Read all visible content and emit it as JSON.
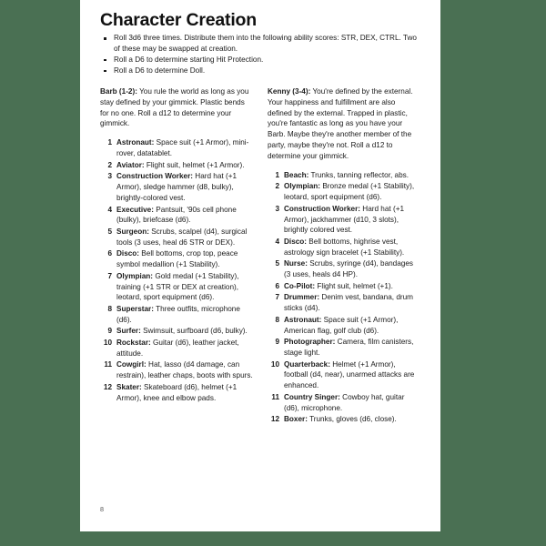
{
  "page": {
    "title": "Character Creation",
    "number": "8",
    "background_color": "#4a7053",
    "paper_color": "#ffffff"
  },
  "intro_rules": [
    "Roll 3d6 three times. Distribute them into the following ability scores: STR, DEX, CTRL. Two of these may be swapped at creation.",
    "Roll a D6 to determine starting Hit Protection.",
    "Roll a D6 to determine Doll."
  ],
  "columns": [
    {
      "heading": "Barb (1-2):",
      "intro": " You rule the world as long as you stay defined by your gimmick. Plastic bends for no one. Roll a d12 to determine your gimmick.",
      "items": [
        {
          "num": "1",
          "name": "Astronaut:",
          "text": " Space suit (+1 Armor), mini-rover, datatablet."
        },
        {
          "num": "2",
          "name": "Aviator:",
          "text": " Flight suit, helmet (+1 Armor)."
        },
        {
          "num": "3",
          "name": "Construction Worker:",
          "text": " Hard hat (+1 Armor), sledge hammer (d8, bulky), brightly-colored vest."
        },
        {
          "num": "4",
          "name": "Executive:",
          "text": " Pantsuit, '90s cell phone (bulky), briefcase (d6)."
        },
        {
          "num": "5",
          "name": "Surgeon:",
          "text": " Scrubs, scalpel (d4), surgical tools (3 uses, heal d6 STR or DEX)."
        },
        {
          "num": "6",
          "name": "Disco:",
          "text": " Bell bottoms, crop top, peace symbol medallion (+1 Stability)."
        },
        {
          "num": "7",
          "name": "Olympian:",
          "text": " Gold medal (+1 Stability), training (+1 STR or DEX at creation), leotard, sport equipment (d6)."
        },
        {
          "num": "8",
          "name": "Superstar:",
          "text": " Three outfits, microphone (d6)."
        },
        {
          "num": "9",
          "name": "Surfer:",
          "text": " Swimsuit, surfboard (d6, bulky)."
        },
        {
          "num": "10",
          "name": "Rockstar:",
          "text": " Guitar (d6), leather jacket, attitude."
        },
        {
          "num": "11",
          "name": "Cowgirl:",
          "text": " Hat, lasso (d4 damage, can restrain), leather chaps, boots with spurs."
        },
        {
          "num": "12",
          "name": "Skater:",
          "text": " Skateboard (d6), helmet (+1 Armor), knee and elbow pads."
        }
      ]
    },
    {
      "heading": "Kenny (3-4):",
      "intro": " You're defined by the external. Your happiness and fulfillment are also defined by the external.  Trapped in plastic, you're fantastic as long as you have your Barb. Maybe they're another member of the party, maybe they're not. Roll a d12 to determine your gimmick.",
      "items": [
        {
          "num": "1",
          "name": "Beach:",
          "text": " Trunks, tanning reflector, abs."
        },
        {
          "num": "2",
          "name": "Olympian:",
          "text": " Bronze medal (+1 Stability), leotard, sport equipment (d6)."
        },
        {
          "num": "3",
          "name": "Construction Worker:",
          "text": " Hard hat (+1 Armor), jackhammer (d10, 3 slots), brightly colored vest."
        },
        {
          "num": "4",
          "name": "Disco:",
          "text": " Bell bottoms, highrise vest, astrology sign bracelet (+1 Stability)."
        },
        {
          "num": "5",
          "name": "Nurse:",
          "text": " Scrubs, syringe (d4), bandages (3 uses, heals d4 HP)."
        },
        {
          "num": "6",
          "name": "Co-Pilot:",
          "text": " Flight suit, helmet (+1)."
        },
        {
          "num": "7",
          "name": "Drummer:",
          "text": " Denim vest, bandana, drum sticks (d4)."
        },
        {
          "num": "8",
          "name": "Astronaut:",
          "text": " Space suit (+1 Armor), American flag, golf club (d6)."
        },
        {
          "num": "9",
          "name": "Photographer:",
          "text": " Camera, film canisters, stage light."
        },
        {
          "num": "10",
          "name": "Quarterback:",
          "text": " Helmet (+1 Armor), football (d4, near), unarmed attacks are enhanced."
        },
        {
          "num": "11",
          "name": "Country Singer:",
          "text": " Cowboy hat, guitar (d6), microphone."
        },
        {
          "num": "12",
          "name": "Boxer:",
          "text": " Trunks, gloves (d6, close)."
        }
      ]
    }
  ]
}
